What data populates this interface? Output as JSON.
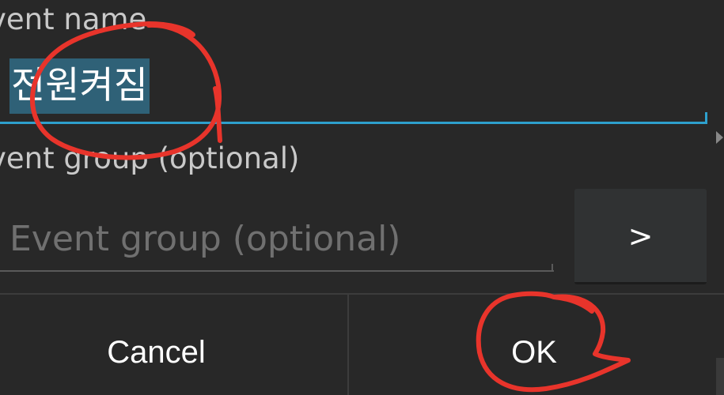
{
  "dialog": {
    "event_name_label": "vent name",
    "event_name_value": "전원켜짐",
    "event_group_label": "vent group (optional)",
    "event_group_placeholder": "Event group (optional)",
    "event_group_value": "",
    "group_picker_label": ">",
    "cancel_label": "Cancel",
    "ok_label": "OK"
  },
  "colors": {
    "background": "#282828",
    "focus_underline": "#2ea0cd",
    "text_selection": "#2f6177",
    "annotation_marker": "#e8342b"
  },
  "annotations": [
    "red-circle-around-event-name",
    "red-circle-around-ok-button"
  ]
}
